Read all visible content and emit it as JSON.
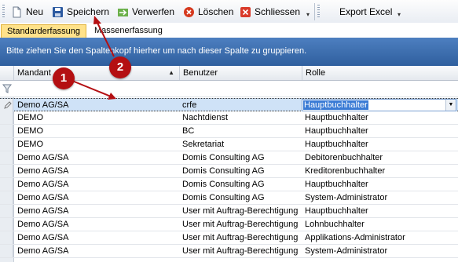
{
  "toolbar": {
    "new_label": "Neu",
    "save_label": "Speichern",
    "discard_label": "Verwerfen",
    "delete_label": "Löschen",
    "close_label": "Schliessen",
    "export_label": "Export Excel"
  },
  "tabs": [
    {
      "label": "Standarderfassung",
      "active": true
    },
    {
      "label": "Massenerfassung",
      "active": false
    }
  ],
  "group_panel_text": "Bitte ziehen Sie den Spaltenkopf hierher um nach dieser Spalte zu gruppieren.",
  "columns": [
    "Mandant",
    "Benutzer",
    "Rolle"
  ],
  "sort_column": "Mandant",
  "editing_row": {
    "mandant": "Demo AG/SA",
    "benutzer": "crfe",
    "rolle": "Hauptbuchhalter"
  },
  "rows": [
    {
      "mandant": "DEMO",
      "benutzer": "Nachtdienst",
      "rolle": "Hauptbuchhalter"
    },
    {
      "mandant": "DEMO",
      "benutzer": "BC",
      "rolle": "Hauptbuchhalter"
    },
    {
      "mandant": "DEMO",
      "benutzer": "Sekretariat",
      "rolle": "Hauptbuchhalter"
    },
    {
      "mandant": "Demo AG/SA",
      "benutzer": "Domis Consulting AG",
      "rolle": "Debitorenbuchhalter"
    },
    {
      "mandant": "Demo AG/SA",
      "benutzer": "Domis Consulting AG",
      "rolle": "Kreditorenbuchhalter"
    },
    {
      "mandant": "Demo AG/SA",
      "benutzer": "Domis Consulting AG",
      "rolle": "Hauptbuchhalter"
    },
    {
      "mandant": "Demo AG/SA",
      "benutzer": "Domis Consulting AG",
      "rolle": "System-Administrator"
    },
    {
      "mandant": "Demo AG/SA",
      "benutzer": "User mit Auftrag-Berechtigung",
      "rolle": "Hauptbuchhalter"
    },
    {
      "mandant": "Demo AG/SA",
      "benutzer": "User mit Auftrag-Berechtigung",
      "rolle": "Lohnbuchhalter"
    },
    {
      "mandant": "Demo AG/SA",
      "benutzer": "User mit Auftrag-Berechtigung",
      "rolle": "Applikations-Administrator"
    },
    {
      "mandant": "Demo AG/SA",
      "benutzer": "User mit Auftrag-Berechtigung",
      "rolle": "System-Administrator"
    }
  ],
  "annotations": [
    {
      "label": "1"
    },
    {
      "label": "2"
    }
  ],
  "colors": {
    "accent": "#b40f12",
    "group_panel": "#3c6cad",
    "active_tab": "#ffe28a",
    "selection": "#3a7bd5"
  }
}
